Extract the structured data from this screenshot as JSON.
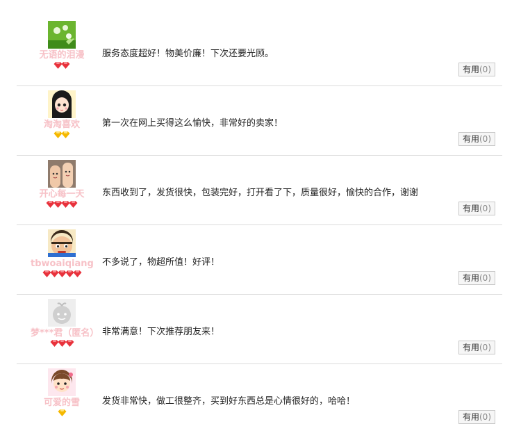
{
  "useful_label": "有用",
  "reviews": [
    {
      "user": "无语的泪漫",
      "badge": "red-diamond",
      "badge_count": 2,
      "text": "服务态度超好！物美价廉！下次还要光顾。",
      "useful_count": "(0)"
    },
    {
      "user": "淘淘喜欢",
      "badge": "yellow-diamond",
      "badge_count": 2,
      "text": "第一次在网上买得这么愉快，非常好的卖家！",
      "useful_count": "(0)"
    },
    {
      "user": "开心每一天",
      "badge": "red-diamond",
      "badge_count": 4,
      "text": "东西收到了，发货很快，包装完好，打开看了下，质量很好，愉快的合作，谢谢",
      "useful_count": "(0)"
    },
    {
      "user": "tbwoaiqiang",
      "badge": "red-diamond",
      "badge_count": 5,
      "text": "不多说了，物超所值！好评！",
      "useful_count": "(0)"
    },
    {
      "user": "梦***君（匿名）",
      "badge": "red-diamond",
      "badge_count": 3,
      "text": "非常满意！下次推荐朋友来！",
      "useful_count": "(0)"
    },
    {
      "user": "可爱的雪",
      "badge": "yellow-diamond",
      "badge_count": 1,
      "text": "发货非常快，做工很整齐，买到好东西总是心情很好的，哈哈！",
      "useful_count": "(0)"
    }
  ],
  "colors": {
    "username": "#f7c1c7",
    "red_diamond": "#e8323c",
    "yellow_diamond": "#f5b800",
    "divider": "#dcdcdc"
  }
}
